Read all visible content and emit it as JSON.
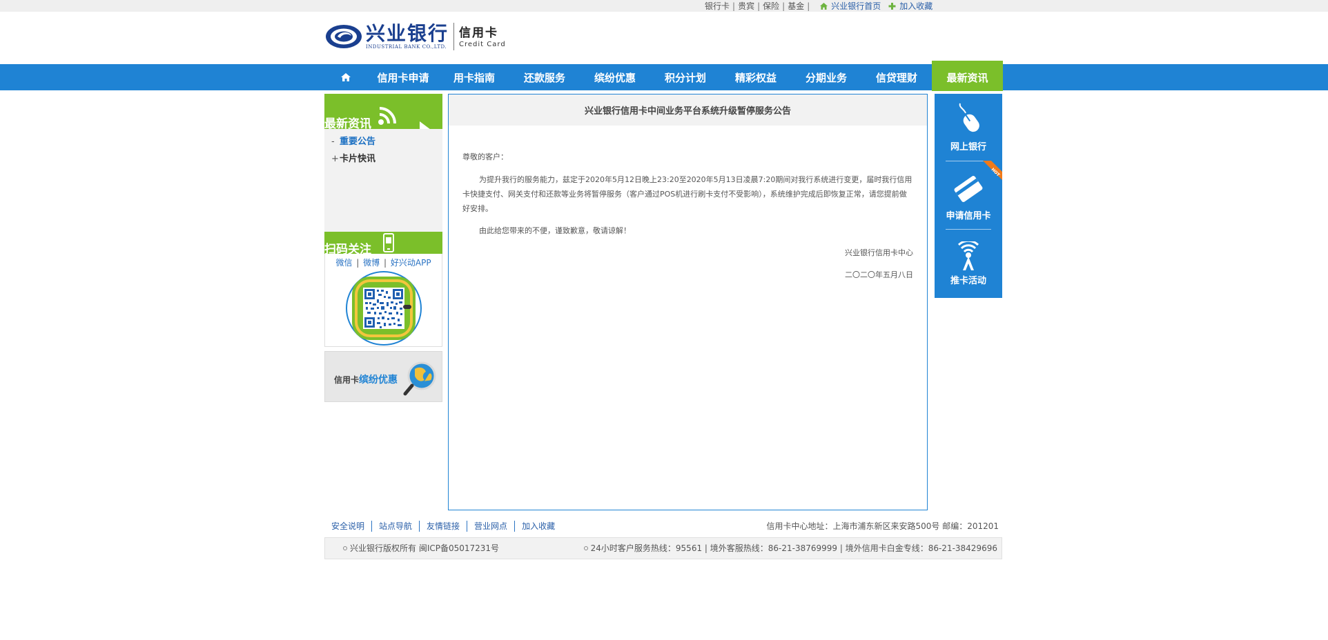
{
  "topbar": {
    "links": [
      "银行卡",
      "贵宾",
      "保险",
      "基金"
    ],
    "home_label": "兴业银行首页",
    "fav_label": "加入收藏"
  },
  "logo": {
    "name_cn": "兴业银行",
    "name_en": "INDUSTRIAL BANK CO.,LTD.",
    "product_cn": "信用卡",
    "product_en": "Credit Card"
  },
  "nav": {
    "items": [
      {
        "label": "信用卡申请"
      },
      {
        "label": "用卡指南"
      },
      {
        "label": "还款服务"
      },
      {
        "label": "缤纷优惠"
      },
      {
        "label": "积分计划"
      },
      {
        "label": "精彩权益"
      },
      {
        "label": "分期业务"
      },
      {
        "label": "信贷理财"
      },
      {
        "label": "最新资讯"
      }
    ],
    "active_index": 8
  },
  "sidebar": {
    "news_title": "最新资讯",
    "news_items": [
      {
        "marker": "-",
        "label": "重要公告"
      },
      {
        "marker": "+",
        "label": "卡片快讯"
      }
    ],
    "scan_title": "扫码关注",
    "scan_links": [
      "微信",
      "微博",
      "好兴动APP"
    ],
    "promo_prefix": "信用卡",
    "promo_highlight": "缤纷优惠"
  },
  "article": {
    "title": "兴业银行信用卡中间业务平台系统升级暂停服务公告",
    "greeting": "尊敬的客户：",
    "paragraph1": "为提升我行的服务能力，兹定于2020年5月12日晚上23:20至2020年5月13日凌晨7:20期间对我行系统进行变更，届时我行信用卡快捷支付、网关支付和还款等业务将暂停服务（客户通过POS机进行刷卡支付不受影响），系统维护完成后即恢复正常，请您提前做好安排。",
    "paragraph2": "由此给您带来的不便，谨致歉意，敬请谅解！",
    "signature": "兴业银行信用卡中心",
    "date": "二〇二〇年五月八日"
  },
  "right_rail": {
    "items": [
      {
        "label": "网上银行",
        "icon": "mouse-icon"
      },
      {
        "label": "申请信用卡",
        "icon": "card-icon"
      },
      {
        "label": "推卡活动",
        "icon": "broadcast-icon"
      }
    ],
    "hot_badge": "HOT"
  },
  "footer": {
    "links": [
      "安全说明",
      "站点导航",
      "友情链接",
      "营业网点",
      "加入收藏"
    ],
    "address": "信用卡中心地址：上海市浦东新区来安路500号 邮编：201201",
    "copyright": "兴业银行版权所有  闽ICP备05017231号",
    "hotlines": "24小时客户服务热线：95561 | 境外客服热线：86-21-38769999 | 境外信用卡白金专线：86-21-38429696"
  },
  "colors": {
    "brand_blue": "#1f83d4",
    "brand_green": "#7bbf2a",
    "logo_navy": "#1a3f8f"
  }
}
